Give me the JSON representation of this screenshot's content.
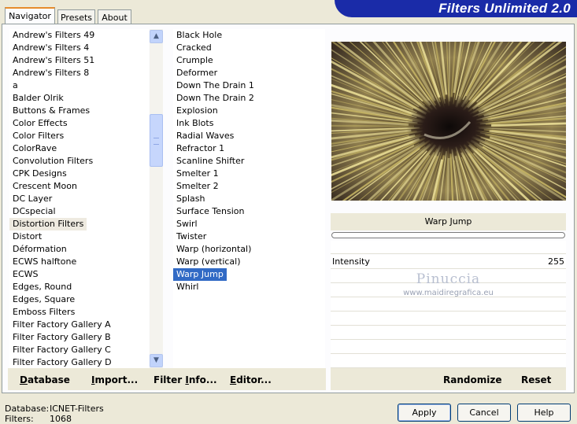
{
  "tabs": [
    {
      "label": "Navigator"
    },
    {
      "label": "Presets"
    },
    {
      "label": "About"
    }
  ],
  "app_title": "Filters Unlimited 2.0",
  "categories": [
    "Andrew's Filters 49",
    "Andrew's Filters 4",
    "Andrew's Filters 51",
    "Andrew's Filters 8",
    "a",
    "Balder Olrik",
    "Buttons & Frames",
    "Color Effects",
    "Color Filters",
    "ColorRave",
    "Convolution Filters",
    "CPK Designs",
    "Crescent Moon",
    "DC Layer",
    "DCspecial",
    "Distortion Filters",
    "Distort",
    "Déformation",
    "ECWS halftone",
    "ECWS",
    "Edges, Round",
    "Edges, Square",
    "Emboss Filters",
    "Filter Factory Gallery A",
    "Filter Factory Gallery B",
    "Filter Factory Gallery C",
    "Filter Factory Gallery D"
  ],
  "selected_category": "Distortion Filters",
  "filters": [
    "Black Hole",
    "Cracked",
    "Crumple",
    "Deformer",
    "Down The Drain 1",
    "Down The Drain 2",
    "Explosion",
    "Ink Blots",
    "Radial Waves",
    "Refractor 1",
    "Scanline Shifter",
    "Smelter 1",
    "Smelter 2",
    "Splash",
    "Surface Tension",
    "Swirl",
    "Twister",
    "Warp (horizontal)",
    "Warp (vertical)",
    "Warp Jump",
    "Whirl"
  ],
  "selected_filter": "Warp Jump",
  "buttons": {
    "database": {
      "u": "D",
      "rest": "atabase"
    },
    "import": {
      "u": "I",
      "rest": "mport..."
    },
    "filter_info": {
      "pre": "Filter ",
      "u": "I",
      "rest": "nfo..."
    },
    "editor": {
      "u": "E",
      "rest": "ditor..."
    },
    "randomize": "Randomize",
    "reset": "Reset"
  },
  "preview": {
    "filter_name": "Warp Jump",
    "watermark_name": "Pinuccia",
    "watermark_url": "www.maidiregrafica.eu"
  },
  "parameters": [
    {
      "label": "Intensity",
      "value": "255"
    }
  ],
  "footer": {
    "database_label": "Database:",
    "database_value": "ICNET-Filters",
    "filters_label": "Filters:",
    "filters_value": "1068"
  },
  "dialog_buttons": {
    "apply": "Apply",
    "cancel": "Cancel",
    "help": "Help"
  }
}
